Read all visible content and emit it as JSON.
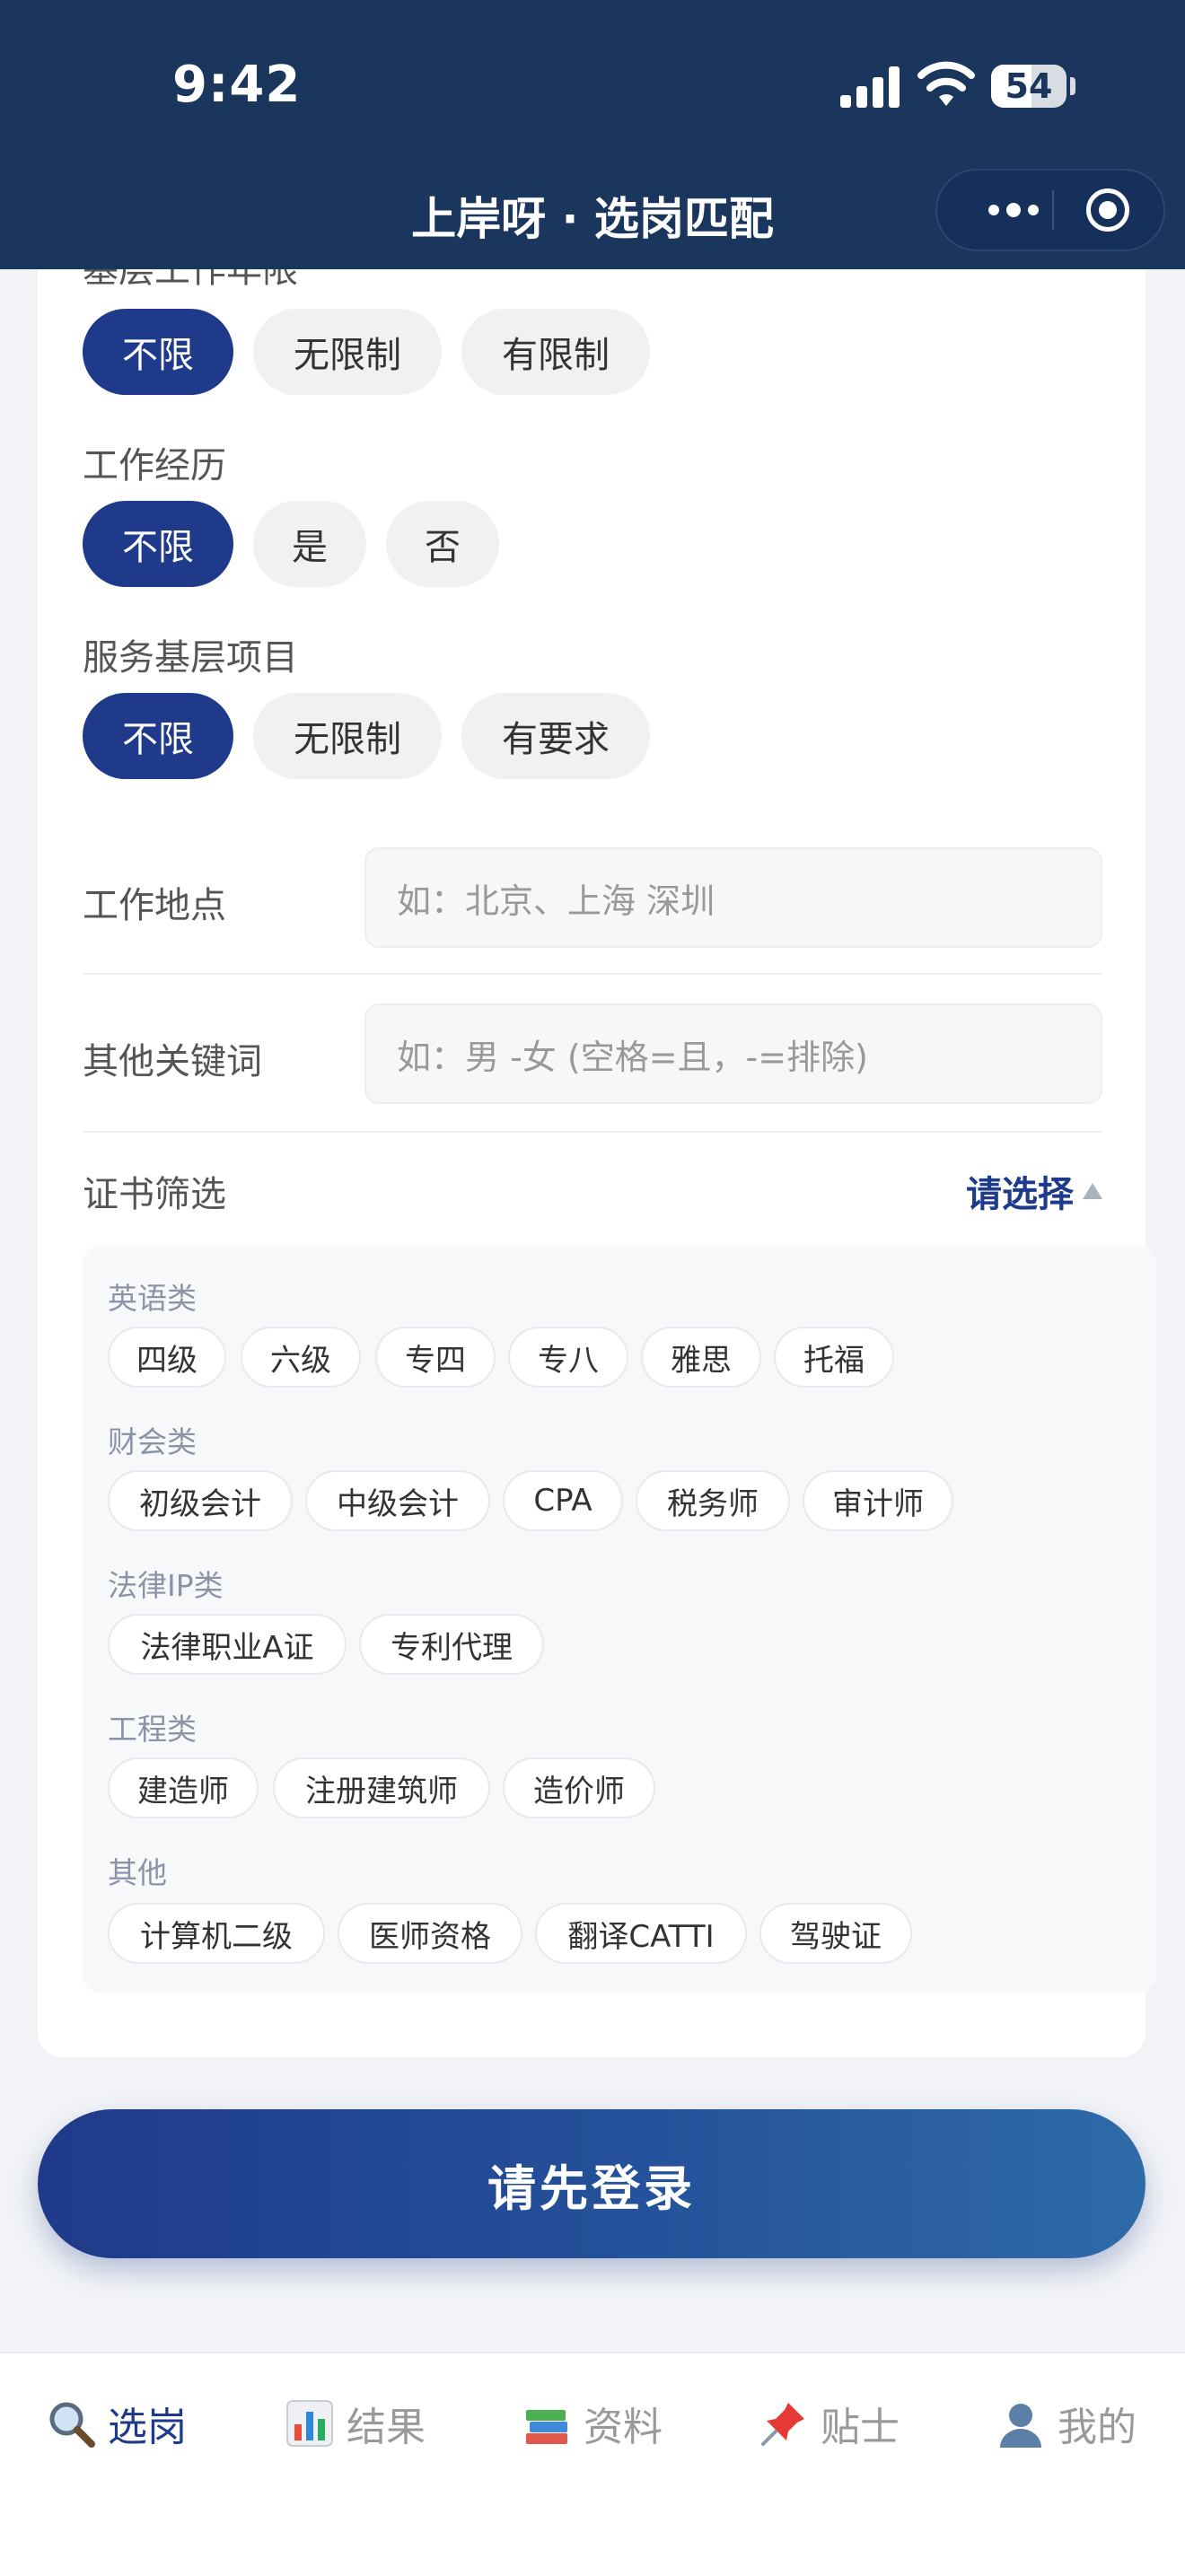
{
  "status": {
    "time": "9:42",
    "battery": "54",
    "battery_level": 0.54
  },
  "nav": {
    "title": "上岸呀 · 选岗匹配"
  },
  "filters": {
    "partial_label": "基层工作年限",
    "group1": {
      "options": [
        "不限",
        "无限制",
        "有限制"
      ]
    },
    "work_exp": {
      "label": "工作经历",
      "options": [
        "不限",
        "是",
        "否"
      ]
    },
    "service": {
      "label": "服务基层项目",
      "options": [
        "不限",
        "无限制",
        "有要求"
      ]
    }
  },
  "location": {
    "label": "工作地点",
    "placeholder": "如：北京、上海 深圳"
  },
  "keywords": {
    "label": "其他关键词",
    "placeholder": "如：男 -女 (空格=且，-=排除)"
  },
  "cert": {
    "label": "证书筛选",
    "choose": "请选择",
    "categories": [
      {
        "name": "英语类",
        "tags": [
          "四级",
          "六级",
          "专四",
          "专八",
          "雅思",
          "托福"
        ]
      },
      {
        "name": "财会类",
        "tags": [
          "初级会计",
          "中级会计",
          "CPA",
          "税务师",
          "审计师"
        ]
      },
      {
        "name": "法律IP类",
        "tags": [
          "法律职业A证",
          "专利代理"
        ]
      },
      {
        "name": "工程类",
        "tags": [
          "建造师",
          "注册建筑师",
          "造价师"
        ]
      },
      {
        "name": "其他",
        "tags": [
          "计算机二级",
          "医师资格",
          "翻译CATTI",
          "驾驶证"
        ]
      }
    ]
  },
  "login_button": "请先登录",
  "tabs": [
    {
      "label": "选岗",
      "icon": "magnifier-icon",
      "active": true
    },
    {
      "label": "结果",
      "icon": "bar-chart-icon"
    },
    {
      "label": "资料",
      "icon": "books-icon"
    },
    {
      "label": "贴士",
      "icon": "pushpin-icon"
    },
    {
      "label": "我的",
      "icon": "user-icon"
    }
  ]
}
